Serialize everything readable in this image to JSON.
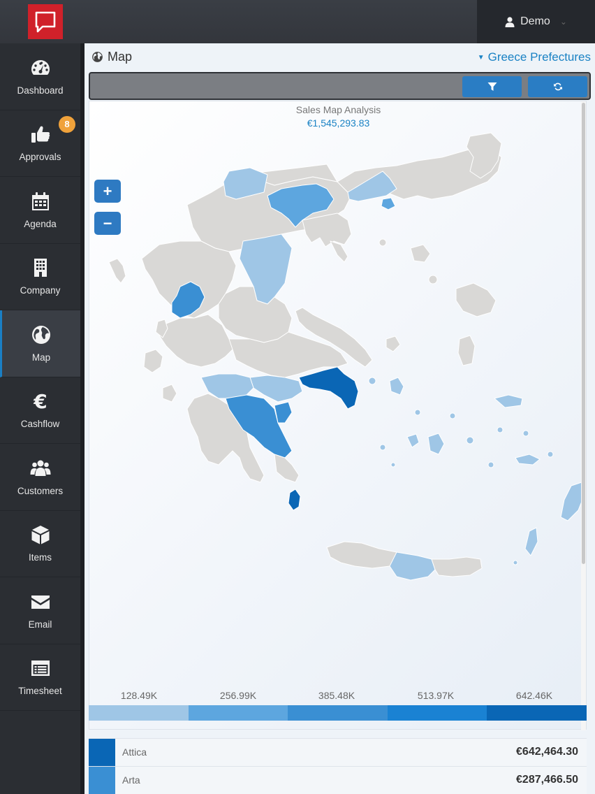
{
  "header": {
    "user_name": "Demo"
  },
  "sidebar": {
    "items": [
      {
        "label": "Dashboard"
      },
      {
        "label": "Approvals",
        "badge": "8"
      },
      {
        "label": "Agenda"
      },
      {
        "label": "Company"
      },
      {
        "label": "Map",
        "active": true
      },
      {
        "label": "Cashflow"
      },
      {
        "label": "Customers"
      },
      {
        "label": "Items"
      },
      {
        "label": "Email"
      },
      {
        "label": "Timesheet"
      }
    ]
  },
  "page": {
    "title": "Map",
    "region_selector": "Greece Prefectures"
  },
  "map": {
    "title": "Sales Map Analysis",
    "total": "€1,545,293.83",
    "zoom_in": "+",
    "zoom_out": "−",
    "colors": {
      "land": "#d9d8d6",
      "c1": "#9fc6e6",
      "c2": "#5da6df",
      "c3": "#3a8fd3",
      "c4": "#0e7acb",
      "c5": "#0a66b5"
    }
  },
  "legend": {
    "labels": [
      "128.49K",
      "256.99K",
      "385.48K",
      "513.97K",
      "642.46K"
    ],
    "colors": [
      "#9fc6e6",
      "#5da6df",
      "#3a8fd3",
      "#1a82d3",
      "#0a66b5"
    ]
  },
  "results": [
    {
      "name": "Attica",
      "value": "€642,464.30",
      "color": "#0a66b5"
    },
    {
      "name": "Arta",
      "value": "€287,466.50",
      "color": "#3a8fd3"
    }
  ]
}
